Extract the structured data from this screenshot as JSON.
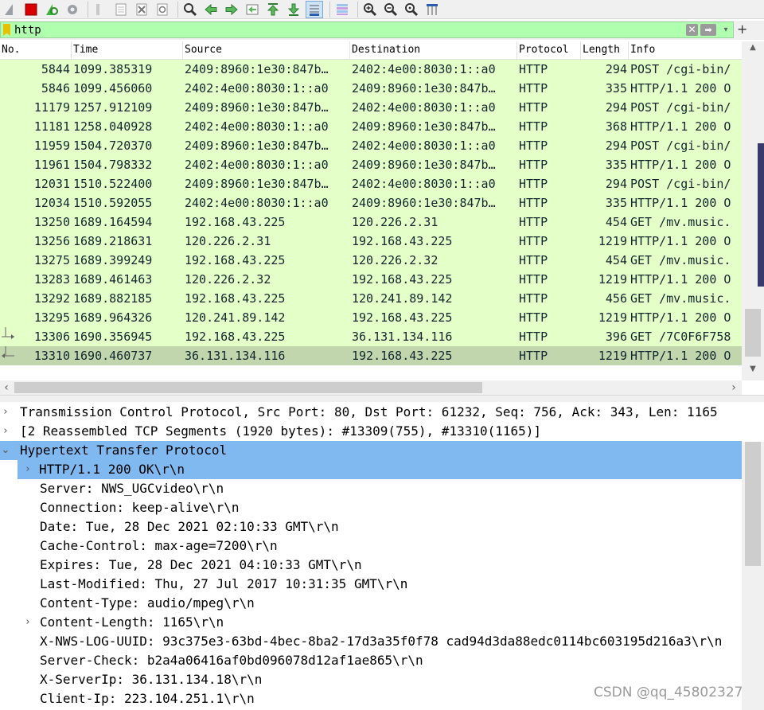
{
  "filter": {
    "value": "http",
    "clear_glyph": "✕",
    "apply_glyph": "➡",
    "dropdown_glyph": "▾",
    "add_glyph": "+"
  },
  "columns": [
    "No.",
    "Time",
    "Source",
    "Destination",
    "Protocol",
    "Length",
    "Info"
  ],
  "packets": [
    {
      "no": "5844",
      "time": "1099.385319",
      "src": "2409:8960:1e30:847b…",
      "dst": "2402:4e00:8030:1::a0",
      "proto": "HTTP",
      "len": "294",
      "info": "POST /cgi-bin/"
    },
    {
      "no": "5846",
      "time": "1099.456060",
      "src": "2402:4e00:8030:1::a0",
      "dst": "2409:8960:1e30:847b…",
      "proto": "HTTP",
      "len": "335",
      "info": "HTTP/1.1 200 O"
    },
    {
      "no": "11179",
      "time": "1257.912109",
      "src": "2409:8960:1e30:847b…",
      "dst": "2402:4e00:8030:1::a0",
      "proto": "HTTP",
      "len": "294",
      "info": "POST /cgi-bin/"
    },
    {
      "no": "11181",
      "time": "1258.040928",
      "src": "2402:4e00:8030:1::a0",
      "dst": "2409:8960:1e30:847b…",
      "proto": "HTTP",
      "len": "368",
      "info": "HTTP/1.1 200 O"
    },
    {
      "no": "11959",
      "time": "1504.720370",
      "src": "2409:8960:1e30:847b…",
      "dst": "2402:4e00:8030:1::a0",
      "proto": "HTTP",
      "len": "294",
      "info": "POST /cgi-bin/"
    },
    {
      "no": "11961",
      "time": "1504.798332",
      "src": "2402:4e00:8030:1::a0",
      "dst": "2409:8960:1e30:847b…",
      "proto": "HTTP",
      "len": "335",
      "info": "HTTP/1.1 200 O"
    },
    {
      "no": "12031",
      "time": "1510.522400",
      "src": "2409:8960:1e30:847b…",
      "dst": "2402:4e00:8030:1::a0",
      "proto": "HTTP",
      "len": "294",
      "info": "POST /cgi-bin/"
    },
    {
      "no": "12034",
      "time": "1510.592055",
      "src": "2402:4e00:8030:1::a0",
      "dst": "2409:8960:1e30:847b…",
      "proto": "HTTP",
      "len": "335",
      "info": "HTTP/1.1 200 O"
    },
    {
      "no": "13250",
      "time": "1689.164594",
      "src": "192.168.43.225",
      "dst": "120.226.2.31",
      "proto": "HTTP",
      "len": "454",
      "info": "GET /mv.music."
    },
    {
      "no": "13256",
      "time": "1689.218631",
      "src": "120.226.2.31",
      "dst": "192.168.43.225",
      "proto": "HTTP",
      "len": "1219",
      "info": "HTTP/1.1 200 O"
    },
    {
      "no": "13275",
      "time": "1689.399249",
      "src": "192.168.43.225",
      "dst": "120.226.2.32",
      "proto": "HTTP",
      "len": "454",
      "info": "GET /mv.music."
    },
    {
      "no": "13283",
      "time": "1689.461463",
      "src": "120.226.2.32",
      "dst": "192.168.43.225",
      "proto": "HTTP",
      "len": "1219",
      "info": "HTTP/1.1 200 O"
    },
    {
      "no": "13292",
      "time": "1689.882185",
      "src": "192.168.43.225",
      "dst": "120.241.89.142",
      "proto": "HTTP",
      "len": "456",
      "info": "GET /mv.music."
    },
    {
      "no": "13295",
      "time": "1689.964326",
      "src": "120.241.89.142",
      "dst": "192.168.43.225",
      "proto": "HTTP",
      "len": "1219",
      "info": "HTTP/1.1 200 O"
    },
    {
      "no": "13306",
      "time": "1690.356945",
      "src": "192.168.43.225",
      "dst": "36.131.134.116",
      "proto": "HTTP",
      "len": "396",
      "info": "GET /7C0F6F758"
    },
    {
      "no": "13310",
      "time": "1690.460737",
      "src": "36.131.134.116",
      "dst": "192.168.43.225",
      "proto": "HTTP",
      "len": "1219",
      "info": "HTTP/1.1 200 O"
    }
  ],
  "selected_packet": "13310",
  "details": [
    {
      "text": "Transmission Control Protocol, Src Port: 80, Dst Port: 61232, Seq: 756, Ack: 343, Len: 1165",
      "caret": "›"
    },
    {
      "text": "[2 Reassembled TCP Segments (1920 bytes): #13309(755), #13310(1165)]",
      "caret": "›"
    },
    {
      "text": "Hypertext Transfer Protocol",
      "caret": "⌄"
    },
    {
      "text": "HTTP/1.1 200 OK\\r\\n",
      "caret": "›"
    },
    {
      "text": "Server: NWS_UGCvideo\\r\\n",
      "caret": ""
    },
    {
      "text": "Connection: keep-alive\\r\\n",
      "caret": ""
    },
    {
      "text": "Date: Tue, 28 Dec 2021 02:10:33 GMT\\r\\n",
      "caret": ""
    },
    {
      "text": "Cache-Control: max-age=7200\\r\\n",
      "caret": ""
    },
    {
      "text": "Expires: Tue, 28 Dec 2021 04:10:33 GMT\\r\\n",
      "caret": ""
    },
    {
      "text": "Last-Modified: Thu, 27 Jul 2017 10:31:35 GMT\\r\\n",
      "caret": ""
    },
    {
      "text": "Content-Type: audio/mpeg\\r\\n",
      "caret": ""
    },
    {
      "text": "Content-Length: 1165\\r\\n",
      "caret": "›"
    },
    {
      "text": "X-NWS-LOG-UUID: 93c375e3-63bd-4bec-8ba2-17d3a35f0f78 cad94d3da88edc0114bc603195d216a3\\r\\n",
      "caret": ""
    },
    {
      "text": "Server-Check: b2a4a06416af0bd096078d12af1ae865\\r\\n",
      "caret": ""
    },
    {
      "text": "X-ServerIp: 36.131.134.18\\r\\n",
      "caret": ""
    },
    {
      "text": "Client-Ip: 223.104.251.1\\r\\n",
      "caret": ""
    }
  ],
  "watermark": "CSDN @qq_45802327",
  "colors": {
    "row_bg": "#e4ffc7",
    "row_selected_bg": "#c1d6ad",
    "detail_highlight": "#80b8f0",
    "filter_valid_bg": "#afffaf"
  }
}
